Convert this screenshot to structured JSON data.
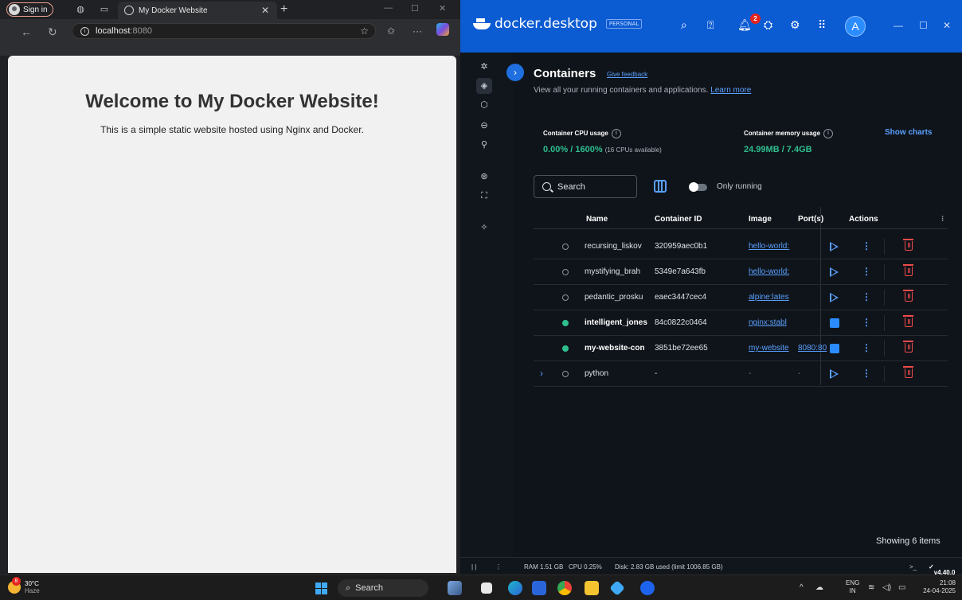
{
  "browser": {
    "signin_label": "Sign in",
    "tab_title": "My Docker Website",
    "url_host": "localhost",
    "url_port": ":8080",
    "page": {
      "heading": "Welcome to My Docker Website!",
      "text": "This is a simple static website hosted using Nginx and Docker."
    }
  },
  "docker": {
    "brand": "docker.desktop",
    "plan_badge": "PERSONAL",
    "notification_count": "2",
    "avatar_letter": "A",
    "title": "Containers",
    "feedback": "Give feedback",
    "subtitle": "View all your running containers and applications.",
    "learn_more": "Learn more",
    "cpu_label": "Container CPU usage",
    "cpu_value": "0.00%",
    "cpu_total": " / 1600%",
    "cpu_note": "(16 CPUs available)",
    "mem_label": "Container memory usage",
    "mem_value": "24.99MB / 7.4GB",
    "show_charts": "Show charts",
    "search_placeholder": "Search",
    "only_running": "Only running",
    "columns": {
      "name": "Name",
      "id": "Container ID",
      "image": "Image",
      "ports": "Port(s)",
      "actions": "Actions"
    },
    "containers": [
      {
        "name": "recursing_liskov",
        "id": "320959aec0b1",
        "image": "hello-world:",
        "ports": "",
        "running": false
      },
      {
        "name": "mystifying_brah",
        "id": "5349e7a643fb",
        "image": "hello-world:",
        "ports": "",
        "running": false
      },
      {
        "name": "pedantic_prosku",
        "id": "eaec3447cec4",
        "image": "alpine:lates",
        "ports": "",
        "running": false
      },
      {
        "name": "intelligent_jones",
        "id": "84c0822c0464",
        "image": "nginx:stabl",
        "ports": "",
        "running": true
      },
      {
        "name": "my-website-con",
        "id": "3851be72ee65",
        "image": "my-website",
        "ports": "8080:80",
        "running": true
      },
      {
        "name": "python",
        "id": "-",
        "image": "-",
        "ports": "-",
        "running": false
      }
    ],
    "showing": "Showing 6 items",
    "footer": {
      "ram": "RAM 1.51 GB",
      "cpu": "CPU 0.25%",
      "disk": "Disk: 2.83 GB used (limit 1006.85 GB)",
      "version": "v4.40.0"
    }
  },
  "taskbar": {
    "weather_count": "8",
    "temp": "30°C",
    "condition": "Haze",
    "search": "Search",
    "lang_top": "ENG",
    "lang_bottom": "IN",
    "time": "21:08",
    "date": "24-04-2025"
  }
}
